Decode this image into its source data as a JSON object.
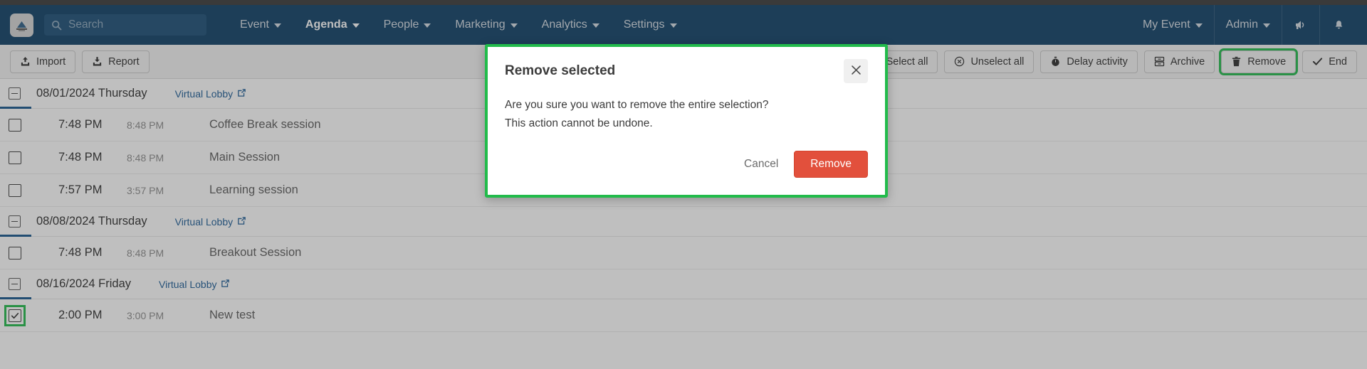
{
  "topbar": {
    "logo_icon": "platform-logo-icon",
    "search": {
      "placeholder": "Search",
      "value": "",
      "icon": "search-icon"
    },
    "nav_items": [
      {
        "label": "Event",
        "active": false,
        "caret": true
      },
      {
        "label": "Agenda",
        "active": true,
        "caret": true
      },
      {
        "label": "People",
        "active": false,
        "caret": true
      },
      {
        "label": "Marketing",
        "active": false,
        "caret": true
      },
      {
        "label": "Analytics",
        "active": false,
        "caret": true
      },
      {
        "label": "Settings",
        "active": false,
        "caret": true
      }
    ],
    "right_items": [
      {
        "label": "My Event",
        "caret": true
      },
      {
        "label": "Admin",
        "caret": true
      }
    ],
    "right_icons": [
      {
        "name": "megaphone-icon"
      },
      {
        "name": "bell-icon"
      }
    ]
  },
  "toolbar": {
    "left_buttons": [
      {
        "label": "Import",
        "icon": "upload-icon",
        "highlighted": false
      },
      {
        "label": "Report",
        "icon": "download-icon",
        "highlighted": false
      }
    ],
    "right_buttons": [
      {
        "label": "Select all",
        "icon": "",
        "highlighted": false
      },
      {
        "label": "Unselect all",
        "icon": "circle-x-icon",
        "highlighted": false
      },
      {
        "label": "Delay activity",
        "icon": "stopwatch-icon",
        "highlighted": false
      },
      {
        "label": "Archive",
        "icon": "archive-icon",
        "highlighted": false
      },
      {
        "label": "Remove",
        "icon": "trash-icon",
        "highlighted": true
      },
      {
        "label": "End",
        "icon": "check-icon",
        "highlighted": false
      }
    ]
  },
  "agenda": {
    "lobby_link_label": "Virtual Lobby",
    "groups": [
      {
        "date": "08/01/2024 Thursday",
        "sessions": [
          {
            "start": "7:48 PM",
            "end": "8:48 PM",
            "title": "Coffee Break session",
            "checked": false,
            "highlighted": false
          },
          {
            "start": "7:48 PM",
            "end": "8:48 PM",
            "title": "Main Session",
            "checked": false,
            "highlighted": false
          },
          {
            "start": "7:57 PM",
            "end": "3:57 PM",
            "title": "Learning session",
            "checked": false,
            "highlighted": false
          }
        ]
      },
      {
        "date": "08/08/2024 Thursday",
        "sessions": [
          {
            "start": "7:48 PM",
            "end": "8:48 PM",
            "title": "Breakout Session",
            "checked": false,
            "highlighted": false
          }
        ]
      },
      {
        "date": "08/16/2024 Friday",
        "sessions": [
          {
            "start": "2:00 PM",
            "end": "3:00 PM",
            "title": "New test",
            "checked": true,
            "highlighted": true
          }
        ]
      }
    ]
  },
  "modal": {
    "title": "Remove selected",
    "close_icon": "close-icon",
    "line1": "Are you sure you want to remove the entire selection?",
    "line2": "This action cannot be undone.",
    "cancel_label": "Cancel",
    "confirm_label": "Remove"
  },
  "colors": {
    "navbar": "#0e3f66",
    "top_strip": "#3a3a3a",
    "highlight_green": "#22bb4b",
    "danger_red": "#e2503c",
    "link_blue": "#1c5c96",
    "date_underline": "#15568c"
  }
}
